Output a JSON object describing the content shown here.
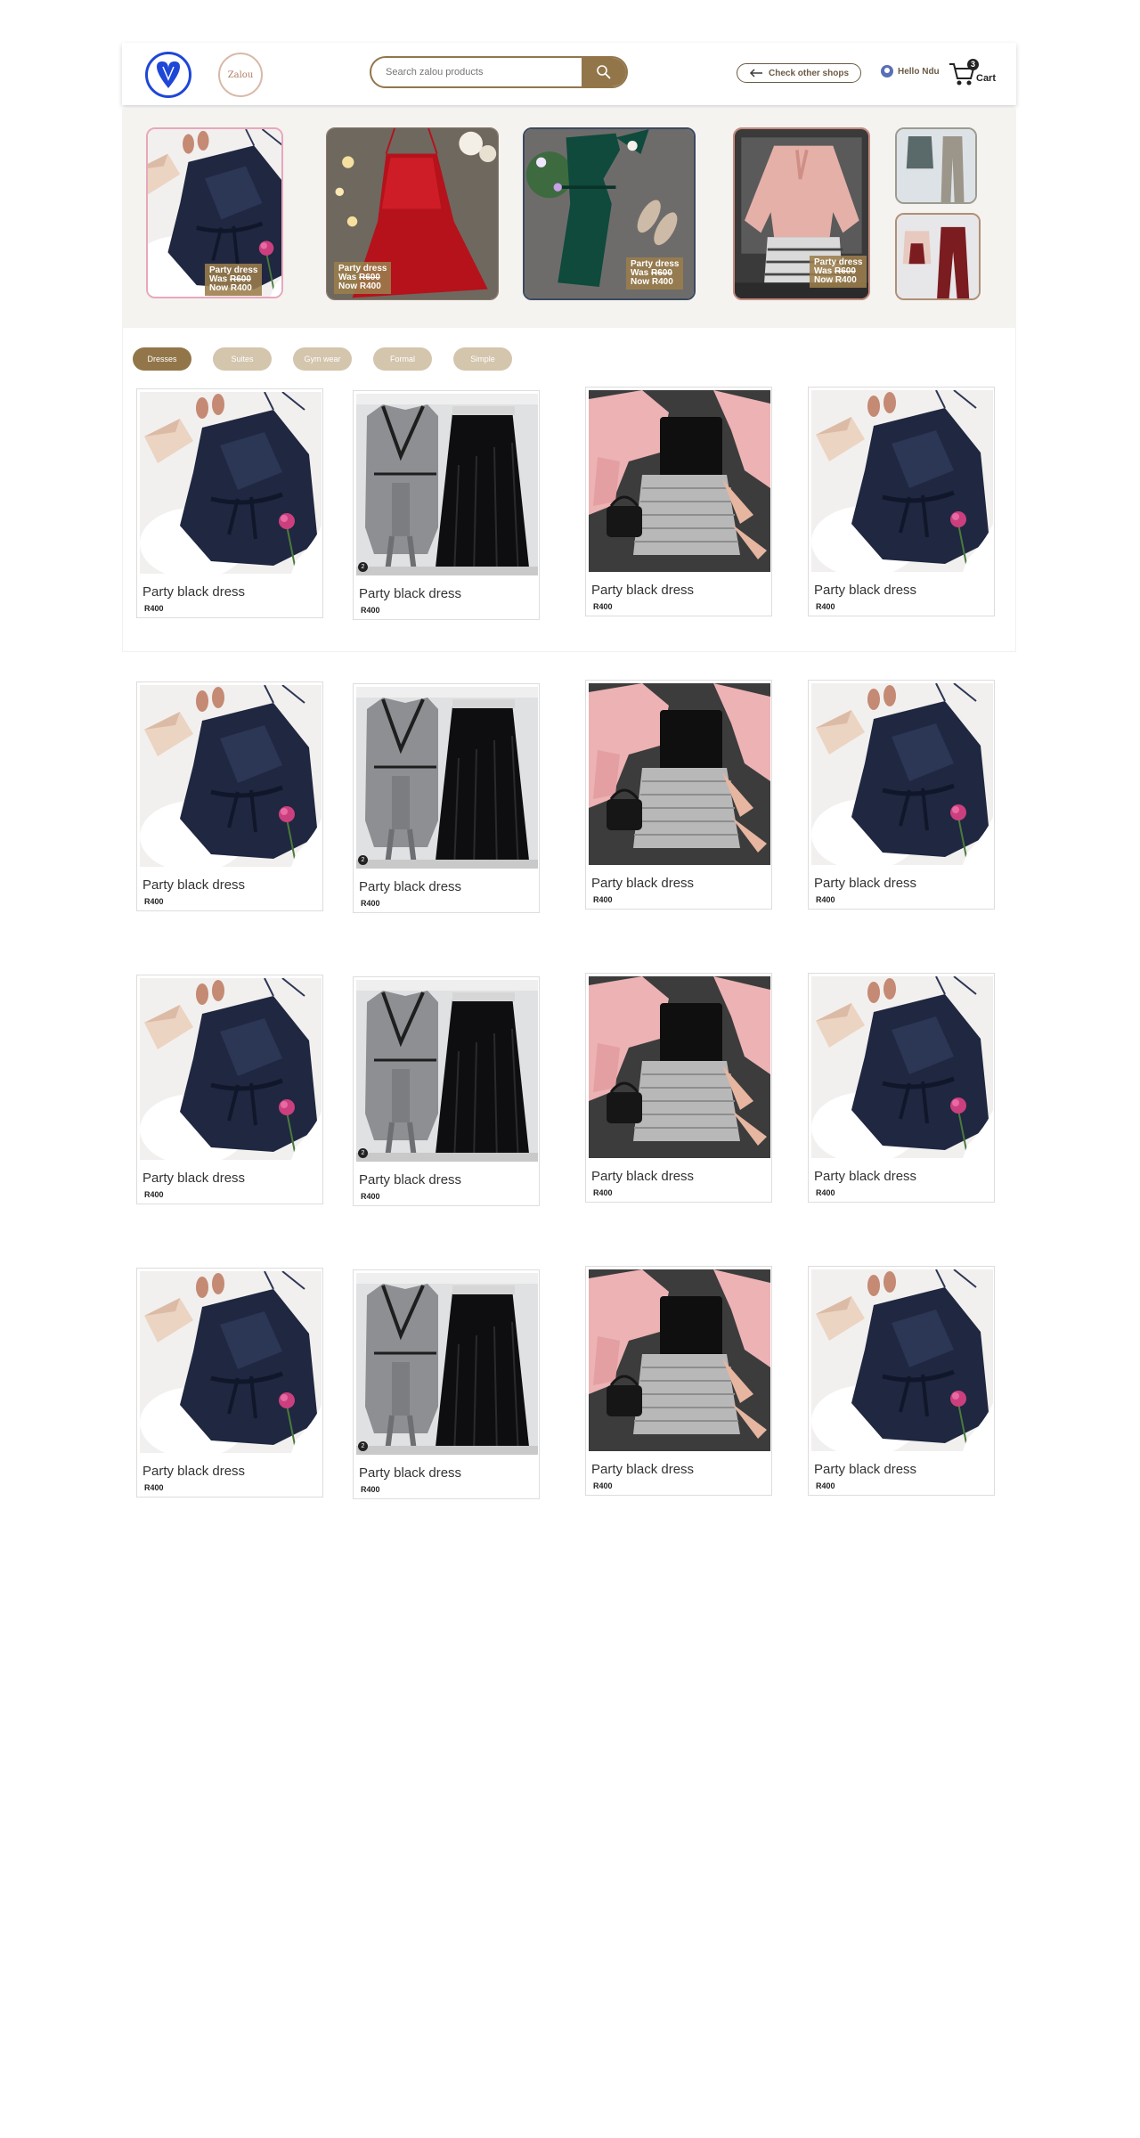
{
  "header": {
    "logo_text": "Zalou",
    "search_placeholder": "Search zalou products",
    "check_shops_label": "Check other shops",
    "user_greeting": "Hello Ndu",
    "cart_count": "3",
    "cart_label": "Cart"
  },
  "banner": {
    "promos": [
      {
        "title": "Party dress",
        "was_label": "Was",
        "was_price": "R600",
        "now_label": "Now",
        "now_price": "R400"
      },
      {
        "title": "Party dress",
        "was_label": "Was",
        "was_price": "R600",
        "now_label": "Now",
        "now_price": "R400"
      },
      {
        "title": "Party dress",
        "was_label": "Was",
        "was_price": "R600",
        "now_label": "Now",
        "now_price": "R400"
      },
      {
        "title": "Party dress",
        "was_label": "Was",
        "was_price": "R600",
        "now_label": "Now",
        "now_price": "R400"
      }
    ]
  },
  "filters": [
    "Dresses",
    "Suites",
    "Gym wear",
    "Formal",
    "Simple"
  ],
  "product": {
    "name": "Party black  dress",
    "price": "R400",
    "badge": "2"
  },
  "colors": {
    "brand": "#92764a",
    "brand_light": "#d4c5ad",
    "logo_blue": "#1e47d8",
    "navy_dress": "#1f2741",
    "red_dress": "#b5121b",
    "green_dress": "#0f4a3c",
    "pink_jacket": "#ecb2b4"
  },
  "icons": [
    "heart-logo-icon",
    "search-icon",
    "arrow-left-icon",
    "user-icon",
    "cart-icon"
  ]
}
